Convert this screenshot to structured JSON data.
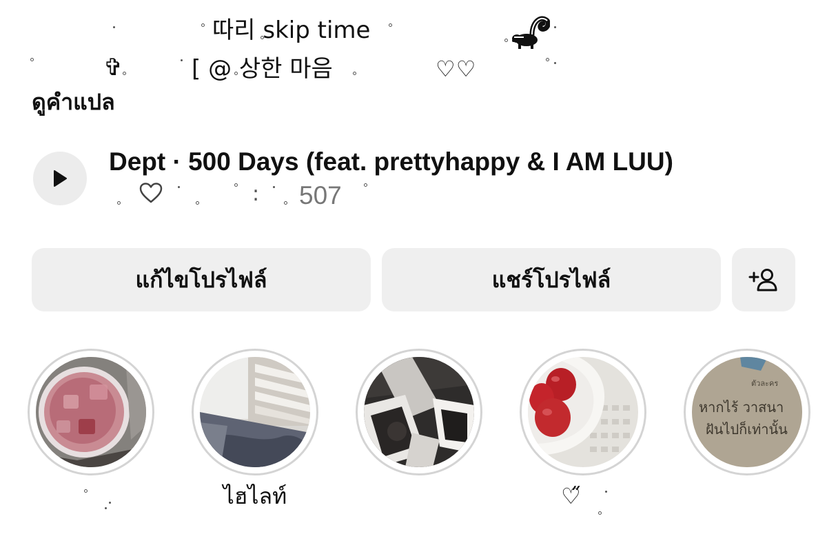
{
  "bio": {
    "line1": "따리 skip time",
    "line2": "[ @ 상한 마음",
    "cross": "✞",
    "hearts": "♡♡",
    "see_translation": "ดูคำแปล"
  },
  "music": {
    "title": "Dept · 500 Days (feat. prettyhappy & I AM LUU)",
    "colon": ":",
    "count": "507"
  },
  "actions": {
    "edit_profile": "แก้ไขโปรไฟล์",
    "share_profile": "แชร์โปรไฟล์"
  },
  "highlights": [
    {
      "label": ""
    },
    {
      "label": "ไฮไลท์"
    },
    {
      "label": ""
    },
    {
      "label": "♡̋"
    },
    {
      "label": ""
    }
  ],
  "highlight_photo_text": {
    "small": "ตัวละคร",
    "line1": "หากไร้ วาสนา",
    "line2": "ฝันไปก็เท่านั้น"
  },
  "icons": [
    "play-icon",
    "heart-outline-icon",
    "add-person-icon",
    "skunk-icon"
  ]
}
